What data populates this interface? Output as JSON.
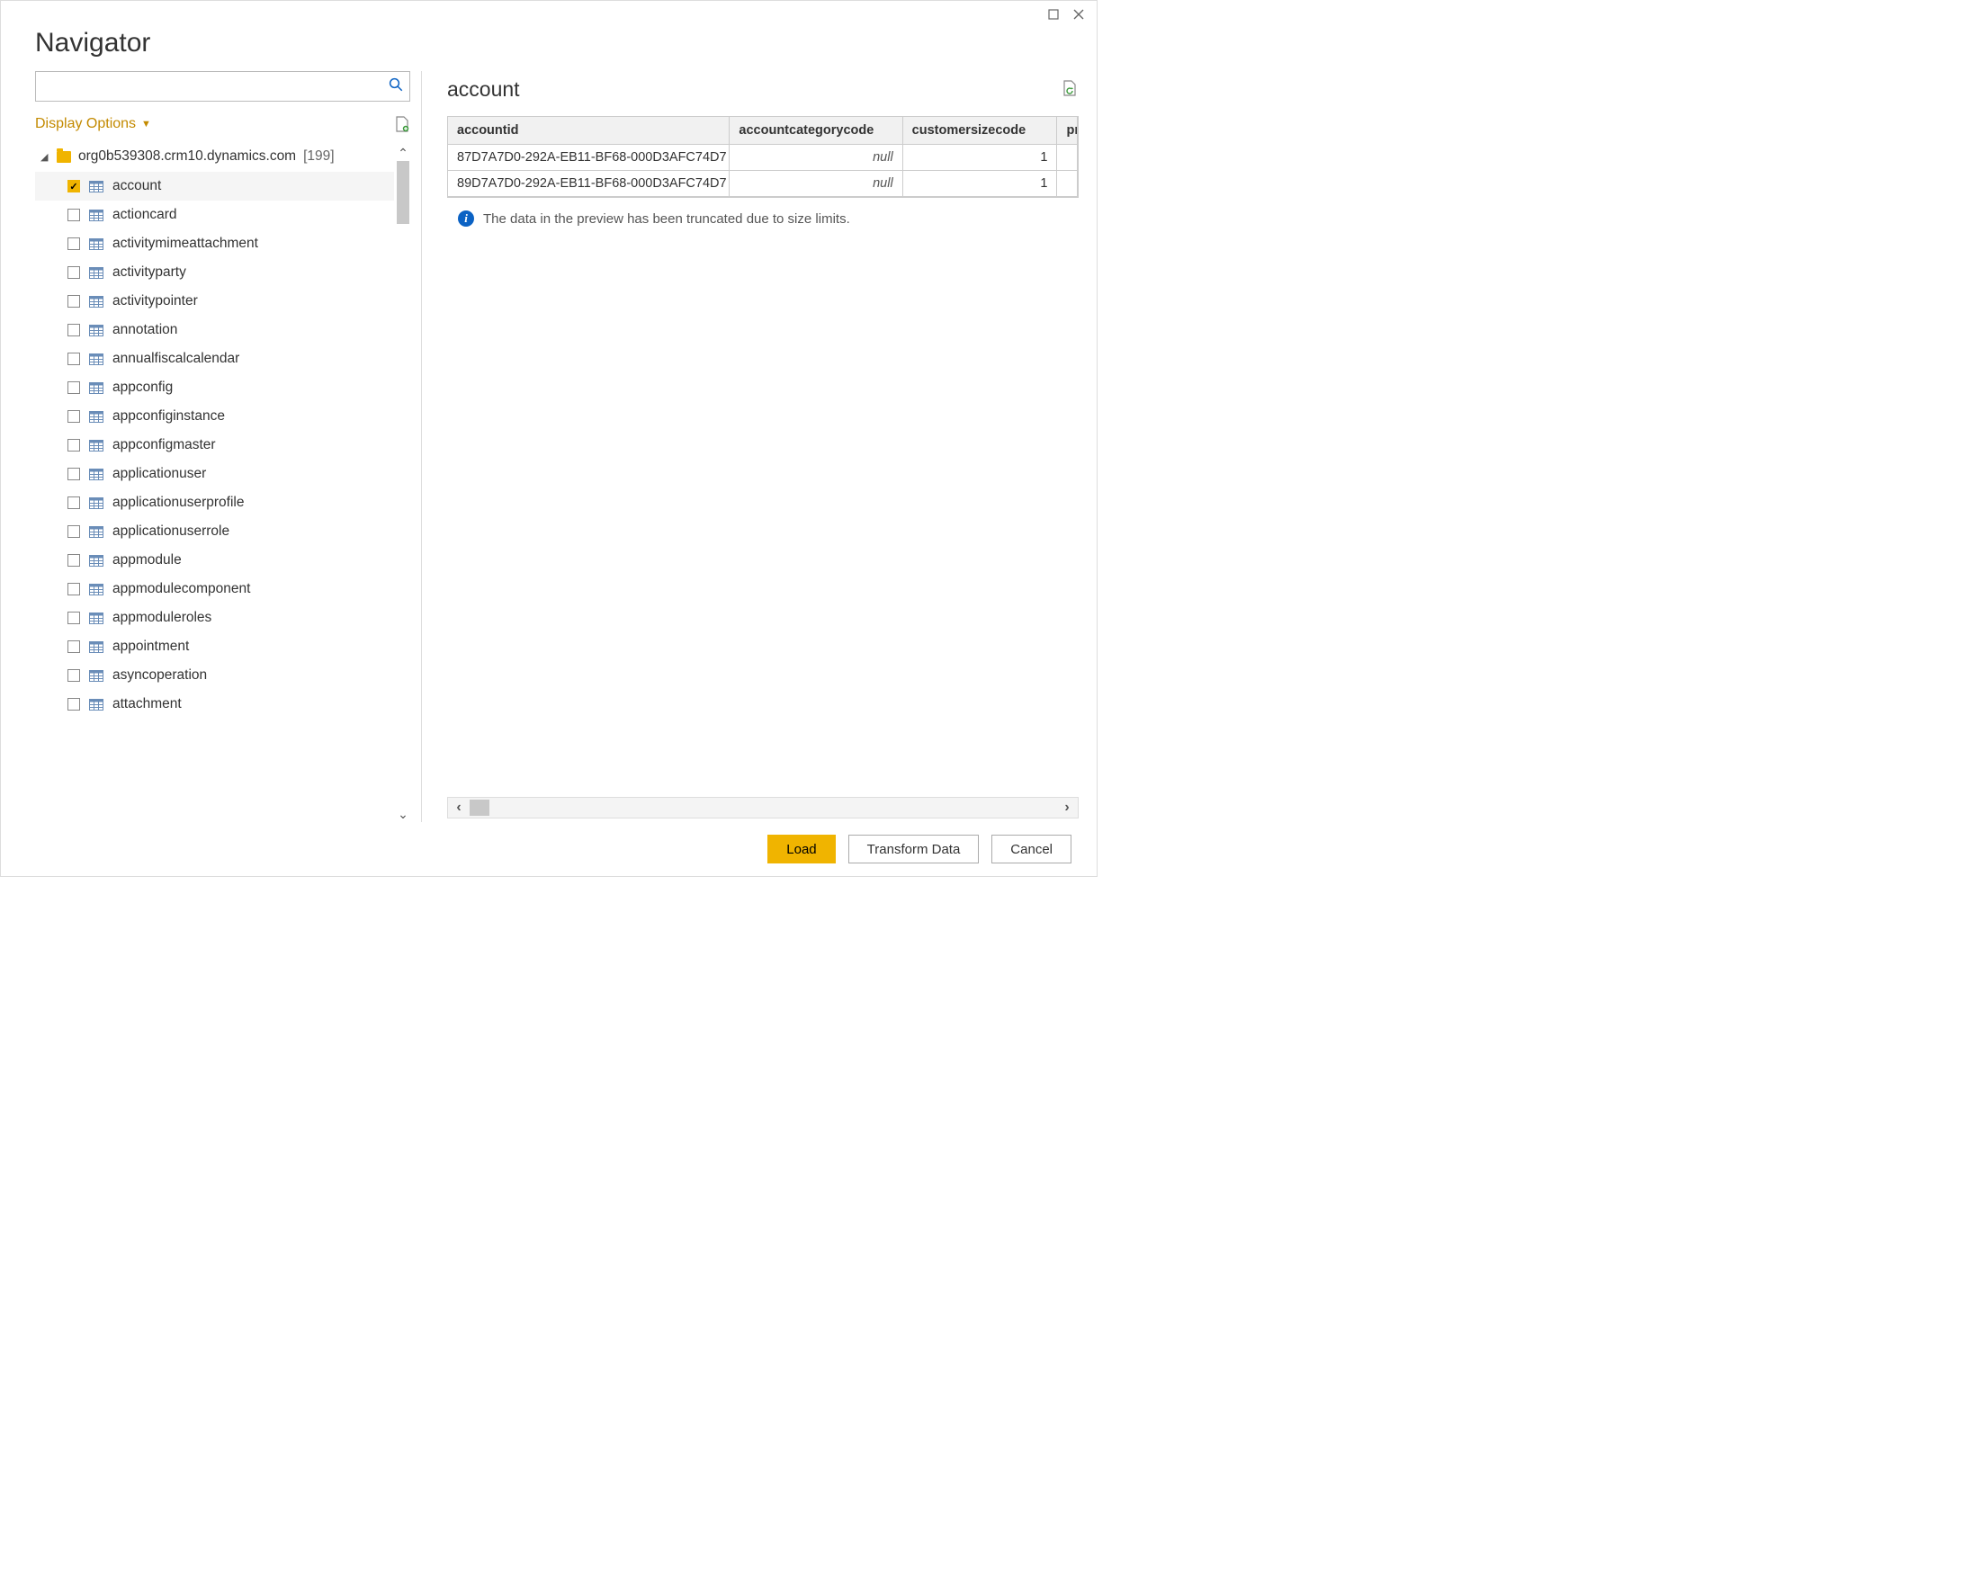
{
  "title": "Navigator",
  "search": {
    "value": "",
    "placeholder": ""
  },
  "display_options_label": "Display Options",
  "tree": {
    "root": {
      "name": "org0b539308.crm10.dynamics.com",
      "count": "[199]"
    },
    "items": [
      {
        "label": "account",
        "checked": true,
        "selected": true
      },
      {
        "label": "actioncard",
        "checked": false
      },
      {
        "label": "activitymimeattachment",
        "checked": false
      },
      {
        "label": "activityparty",
        "checked": false
      },
      {
        "label": "activitypointer",
        "checked": false
      },
      {
        "label": "annotation",
        "checked": false
      },
      {
        "label": "annualfiscalcalendar",
        "checked": false
      },
      {
        "label": "appconfig",
        "checked": false
      },
      {
        "label": "appconfiginstance",
        "checked": false
      },
      {
        "label": "appconfigmaster",
        "checked": false
      },
      {
        "label": "applicationuser",
        "checked": false
      },
      {
        "label": "applicationuserprofile",
        "checked": false
      },
      {
        "label": "applicationuserrole",
        "checked": false
      },
      {
        "label": "appmodule",
        "checked": false
      },
      {
        "label": "appmodulecomponent",
        "checked": false
      },
      {
        "label": "appmoduleroles",
        "checked": false
      },
      {
        "label": "appointment",
        "checked": false
      },
      {
        "label": "asyncoperation",
        "checked": false
      },
      {
        "label": "attachment",
        "checked": false
      }
    ]
  },
  "preview": {
    "title": "account",
    "columns": [
      "accountid",
      "accountcategorycode",
      "customersizecode",
      "pr"
    ],
    "rows": [
      {
        "accountid": "87D7A7D0-292A-EB11-BF68-000D3AFC74D7",
        "accountcategorycode": "null",
        "customersizecode": "1"
      },
      {
        "accountid": "89D7A7D0-292A-EB11-BF68-000D3AFC74D7",
        "accountcategorycode": "null",
        "customersizecode": "1"
      }
    ],
    "info": "The data in the preview has been truncated due to size limits."
  },
  "buttons": {
    "load": "Load",
    "transform": "Transform Data",
    "cancel": "Cancel"
  }
}
